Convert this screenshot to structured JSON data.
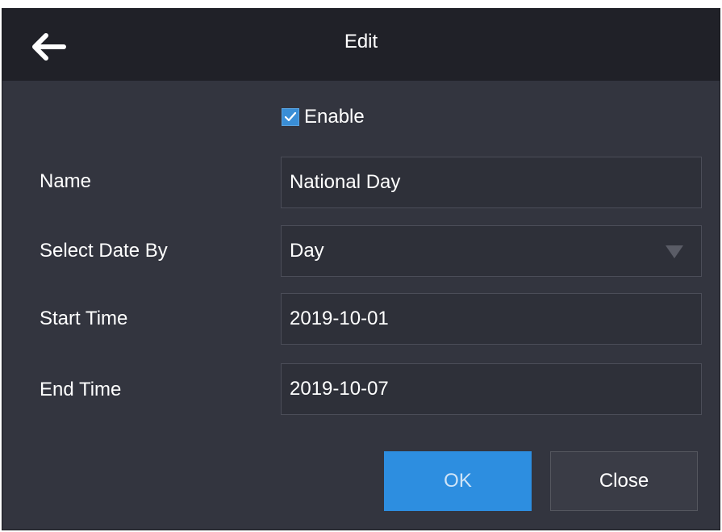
{
  "header": {
    "title": "Edit",
    "back_icon": "arrow-left-icon"
  },
  "form": {
    "enable": {
      "label": "Enable",
      "checked": true
    },
    "name": {
      "label": "Name",
      "value": "National Day"
    },
    "select_date_by": {
      "label": "Select Date By",
      "value": "Day"
    },
    "start_time": {
      "label": "Start Time",
      "value": "2019-10-01"
    },
    "end_time": {
      "label": "End Time",
      "value": "2019-10-07"
    }
  },
  "buttons": {
    "ok_label": "OK",
    "close_label": "Close"
  },
  "colors": {
    "background": "#33353f",
    "header": "#202128",
    "accent": "#2d8ee0"
  }
}
